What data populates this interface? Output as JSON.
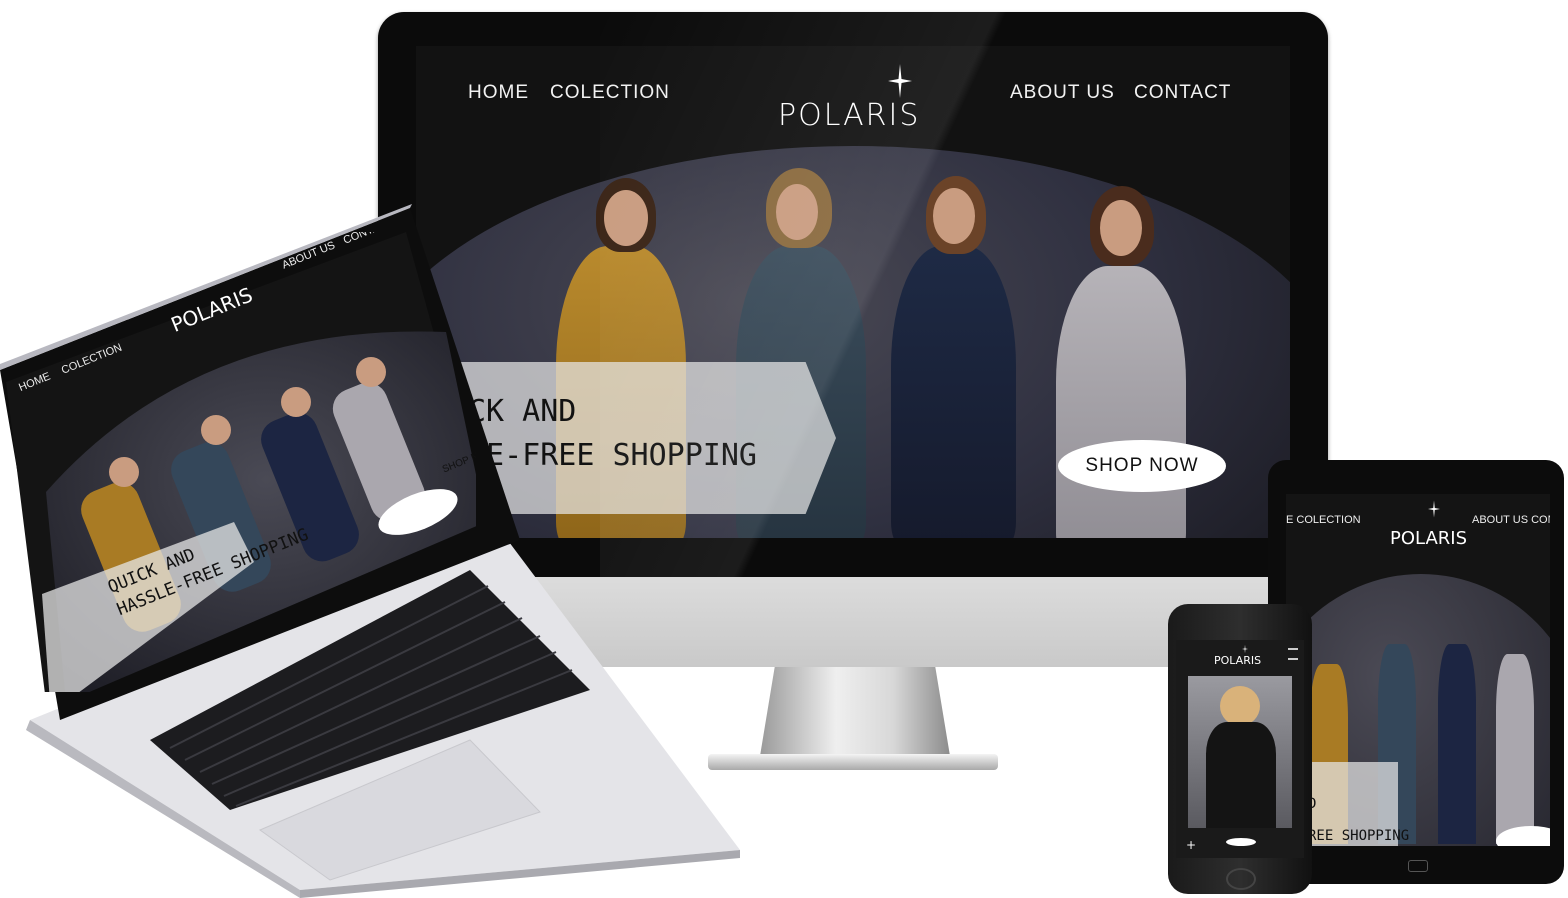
{
  "desktop": {
    "nav_left": [
      "HOME",
      "COLECTION"
    ],
    "nav_right": [
      "ABOUT US",
      "CONTACT"
    ],
    "logo": "POLARIS",
    "banner_line1": "CK AND",
    "banner_line2": "LE-FREE SHOPPING",
    "cta": "SHOP NOW"
  },
  "laptop": {
    "nav_left": [
      "HOME",
      "COLECTION"
    ],
    "nav_right": [
      "ABOUT US",
      "CONTACT"
    ],
    "logo": "POLARIS",
    "banner_line1": "QUICK AND",
    "banner_line2": "HASSLE-FREE SHOPPING",
    "cta": "SHOP NOW"
  },
  "tablet": {
    "nav_left": "E COLECTION",
    "nav_right": "ABOUT US CONT",
    "logo": "POLARIS",
    "banner_line1": "D",
    "banner_line2": "REE SHOPPING"
  },
  "phone": {
    "logo": "POLARIS"
  },
  "colors": {
    "site_bg": "#121212",
    "accent": "#ffffff",
    "banner": "#e6e6e6"
  }
}
